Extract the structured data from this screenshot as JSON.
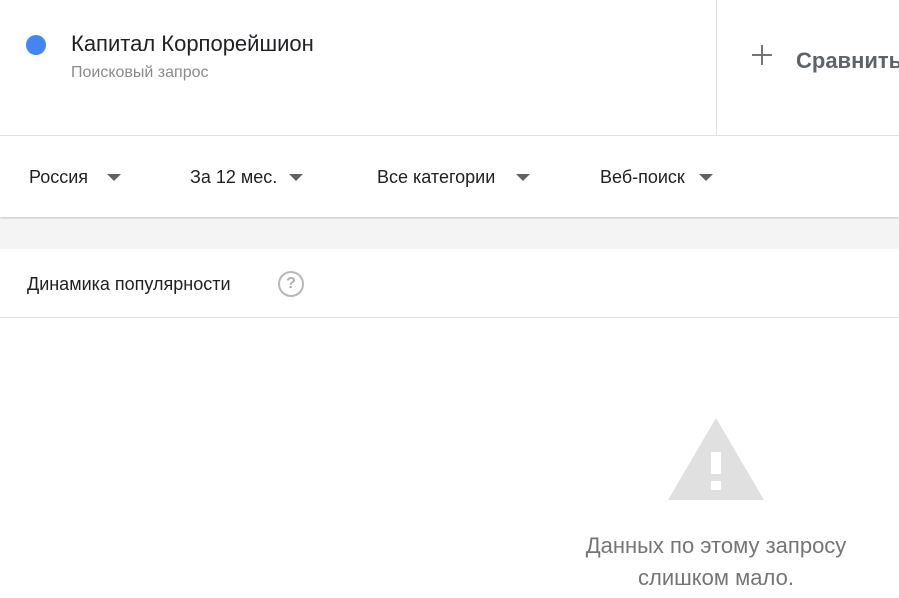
{
  "term": {
    "dot_color": "#4285f4",
    "title": "Капитал Корпорейшион",
    "subtitle": "Поисковый запрос"
  },
  "compare": {
    "icon": "plus-icon",
    "label": "Сравнить"
  },
  "filters": [
    {
      "label": "Россия",
      "icon": "dropdown-arrow-icon"
    },
    {
      "label": "За 12 мес.",
      "icon": "dropdown-arrow-icon"
    },
    {
      "label": "Все категории",
      "icon": "dropdown-arrow-icon"
    },
    {
      "label": "Веб-поиск",
      "icon": "dropdown-arrow-icon"
    }
  ],
  "panel": {
    "title": "Динамика популярности",
    "help_icon": "help-circle-icon",
    "help_glyph": "?",
    "warning_icon": "warning-icon",
    "empty_line1": "Данных по этому запросу",
    "empty_line2": "слишком мало."
  }
}
